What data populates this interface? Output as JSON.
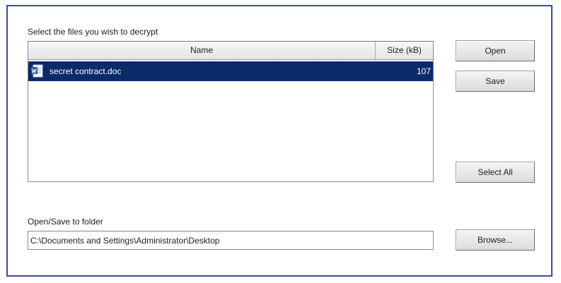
{
  "dialog": {
    "files_label": "Select the files you wish to decrypt",
    "folder_label": "Open/Save to folder"
  },
  "file_list": {
    "columns": {
      "name": "Name",
      "size": "Size (kB)"
    },
    "rows": [
      {
        "name": "secret contract.doc",
        "size": "107",
        "icon": "word-document-icon",
        "selected": true
      }
    ]
  },
  "buttons": {
    "open": "Open",
    "save": "Save",
    "select_all": "Select All",
    "browse": "Browse..."
  },
  "folder": {
    "path": "C:\\Documents and Settings\\Administrator\\Desktop"
  },
  "colors": {
    "frame_border": "#3c4f8e",
    "selection": "#0a2a6a",
    "icon_blue": "#2b579a"
  }
}
